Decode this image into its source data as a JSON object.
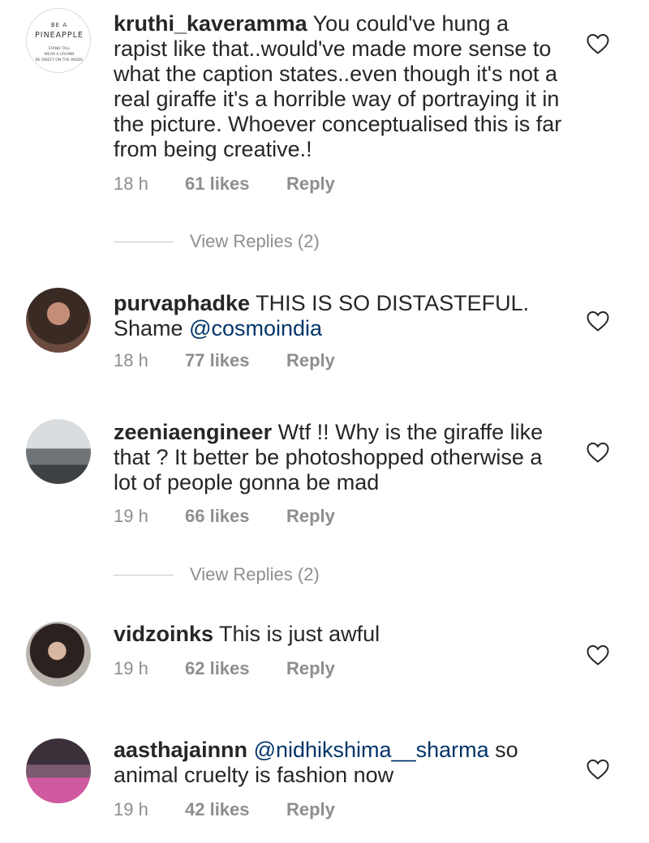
{
  "comments": [
    {
      "username": "kruthi_kaveramma",
      "text": "You could've hung a rapist like that..would've made more sense to what the caption states..even though it's not a real giraffe it's a horrible way of portraying it in the picture. Whoever conceptualised this is far from being creative.!",
      "time": "18 h",
      "likes": "61 likes",
      "reply": "Reply",
      "avatar_text": {
        "line1": "BE A",
        "line2": "PINEAPPLE",
        "line3": "STAND TALL",
        "line4": "WEAR A CROWN",
        "line5": "BE SWEET ON THE INSIDE"
      }
    },
    {
      "username": "purvaphadke",
      "text": "THIS IS SO DISTASTEFUL. Shame ",
      "mention": "@cosmoindia",
      "time": "18 h",
      "likes": "77 likes",
      "reply": "Reply"
    },
    {
      "username": "zeeniaengineer",
      "text": "Wtf !! Why is the giraffe like that ?  It better be photoshopped otherwise a lot of people gonna be mad",
      "time": "19 h",
      "likes": "66 likes",
      "reply": "Reply"
    },
    {
      "username": "vidzoinks",
      "text": "This is just awful",
      "time": "19 h",
      "likes": "62 likes",
      "reply": "Reply"
    },
    {
      "username": "aasthajainnn",
      "mention": "@nidhikshima__sharma",
      "text": " so animal cruelty is fashion now",
      "time": "19 h",
      "likes": "42 likes",
      "reply": "Reply"
    }
  ],
  "view_replies": [
    {
      "label": "View Replies (2)"
    },
    {
      "label": "View Replies (2)"
    }
  ],
  "icons": {
    "like": "heart-outline-icon"
  },
  "colors": {
    "text": "#262626",
    "meta": "#8e8e8e",
    "mention": "#003569"
  }
}
